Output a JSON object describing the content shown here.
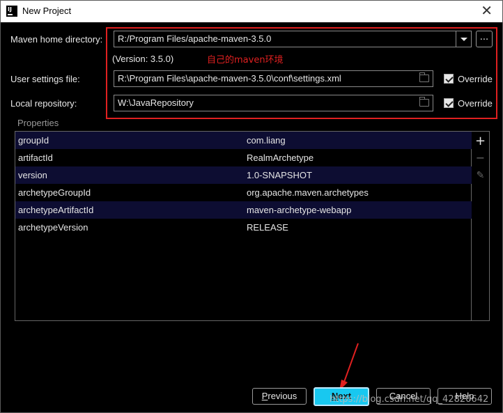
{
  "window": {
    "title": "New Project"
  },
  "form": {
    "maven_home_label": "Maven home directory:",
    "maven_home_value": "R:/Program Files/apache-maven-3.5.0",
    "browse_label": "...",
    "version_text": "(Version: 3.5.0)",
    "annotation": "自己的maven环境",
    "user_settings_label": "User settings file:",
    "user_settings_value": "R:\\Program Files\\apache-maven-3.5.0\\conf\\settings.xml",
    "override_label": "Override",
    "local_repo_label": "Local repository:",
    "local_repo_value": "W:\\JavaRepository"
  },
  "properties": {
    "title": "Properties",
    "rows": [
      {
        "key": "groupId",
        "value": "com.liang"
      },
      {
        "key": "artifactId",
        "value": "RealmArchetype"
      },
      {
        "key": "version",
        "value": "1.0-SNAPSHOT"
      },
      {
        "key": "archetypeGroupId",
        "value": "org.apache.maven.archetypes"
      },
      {
        "key": "archetypeArtifactId",
        "value": "maven-archetype-webapp"
      },
      {
        "key": "archetypeVersion",
        "value": "RELEASE"
      }
    ],
    "tools": {
      "add": "+",
      "remove": "−",
      "edit": "✎"
    }
  },
  "buttons": {
    "previous_prefix": "",
    "previous_u": "P",
    "previous_rest": "revious",
    "next_prefix": "",
    "next_u": "N",
    "next_rest": "ext",
    "cancel": "Cancel",
    "help": "Help"
  },
  "watermark": "https://blog.csdn.net/qq_42820642",
  "colors": {
    "accent": "#18c8f0",
    "annotation": "#e02020",
    "row_highlight": "#0d0d32"
  }
}
